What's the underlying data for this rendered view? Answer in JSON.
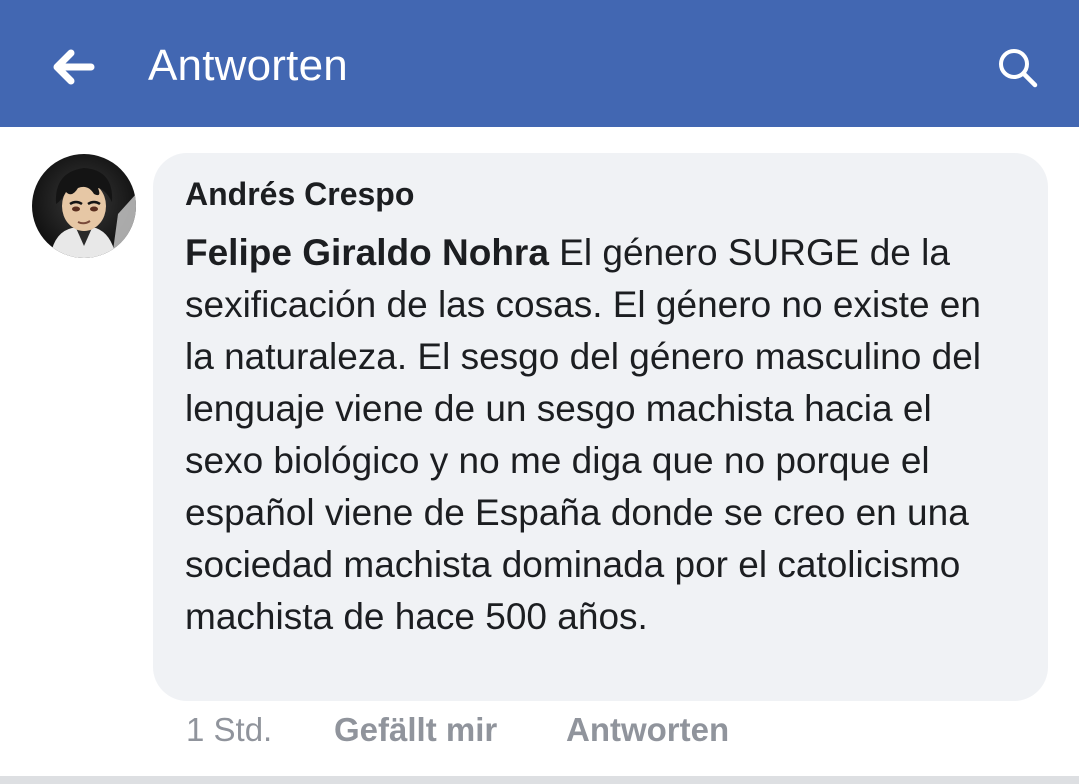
{
  "appbar": {
    "title": "Antworten",
    "back_icon": "arrow-left-icon",
    "search_icon": "search-icon",
    "background": "#4267b2"
  },
  "comment": {
    "author": "Andrés Crespo",
    "mention": "Felipe Giraldo Nohra",
    "text": " El género SURGE de la sexificación de las cosas. El género no existe en la naturaleza. El sesgo del género masculino del lenguaje viene de un sesgo machista hacia el sexo biológico y no me diga que no porque el español viene de España donde se creo en una sociedad machista dominada por el catolicismo machista de hace 500 años.",
    "bubble_color": "#f0f2f5"
  },
  "actions": {
    "time": "1 Std.",
    "like": "Gefällt mir",
    "reply": "Antworten"
  }
}
